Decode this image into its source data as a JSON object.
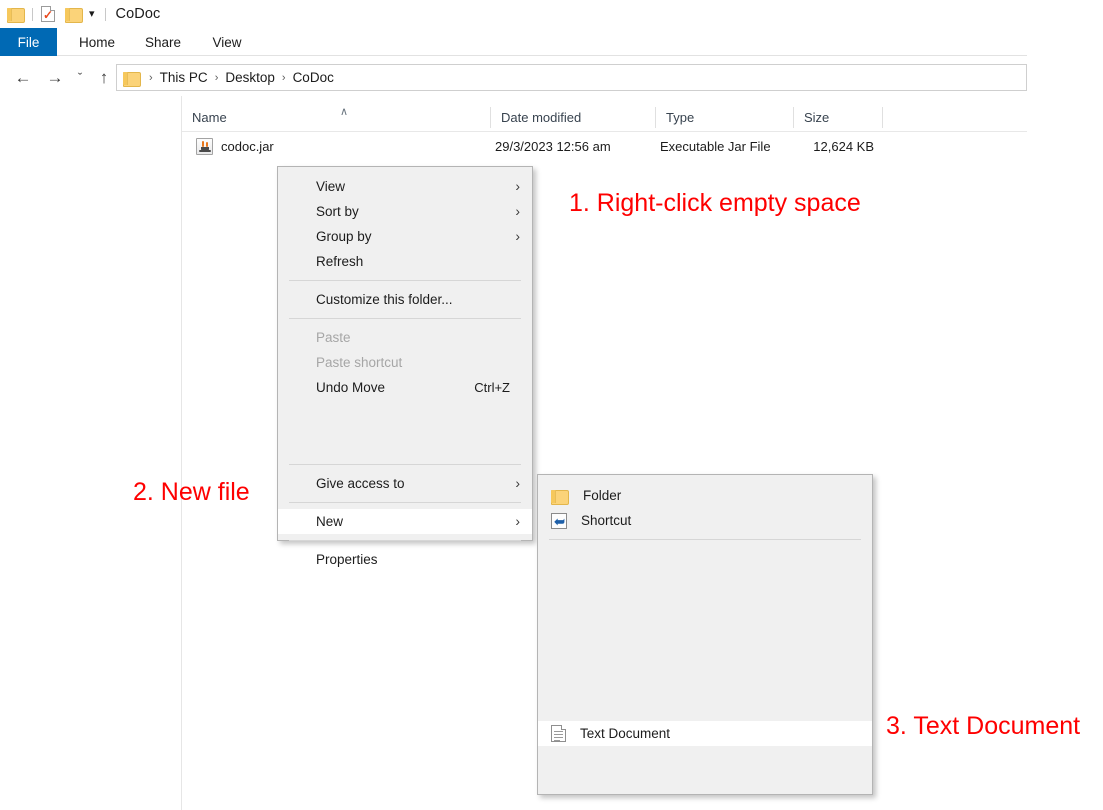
{
  "window": {
    "title": "CoDoc",
    "quick_access": [
      {
        "name": "folder-icon",
        "label": ""
      },
      {
        "name": "properties-icon",
        "label": ""
      },
      {
        "name": "new-folder-icon",
        "label": ""
      },
      {
        "name": "customize-quick-access-caret",
        "label": ""
      }
    ]
  },
  "ribbon": {
    "tabs": [
      {
        "label": "File",
        "active": true
      },
      {
        "label": "Home",
        "active": false
      },
      {
        "label": "Share",
        "active": false
      },
      {
        "label": "View",
        "active": false
      }
    ]
  },
  "address_bar": {
    "back": "←",
    "forward": "→",
    "recent": "ˇ",
    "up": "↑",
    "breadcrumbs": [
      "This PC",
      "Desktop",
      "CoDoc"
    ],
    "separator": "›"
  },
  "file_list": {
    "columns": [
      {
        "label": "Name",
        "sorted": "asc",
        "sort_glyph": "∧"
      },
      {
        "label": "Date modified",
        "sorted": "",
        "sort_glyph": ""
      },
      {
        "label": "Type",
        "sorted": "",
        "sort_glyph": ""
      },
      {
        "label": "Size",
        "sorted": "",
        "sort_glyph": ""
      }
    ],
    "rows": [
      {
        "icon": "java-jar-icon",
        "name": "codoc.jar",
        "date_modified": "29/3/2023 12:56 am",
        "type": "Executable Jar File",
        "size": "12,624 KB"
      }
    ]
  },
  "context_menu": {
    "items": [
      {
        "label": "View",
        "submenu": true,
        "disabled": false,
        "highlighted": false,
        "accel": ""
      },
      {
        "label": "Sort by",
        "submenu": true,
        "disabled": false,
        "highlighted": false,
        "accel": ""
      },
      {
        "label": "Group by",
        "submenu": true,
        "disabled": false,
        "highlighted": false,
        "accel": ""
      },
      {
        "label": "Refresh",
        "submenu": false,
        "disabled": false,
        "highlighted": false,
        "accel": ""
      },
      {
        "label": "Customize this folder...",
        "submenu": false,
        "disabled": false,
        "highlighted": false,
        "accel": ""
      },
      {
        "label": "Paste",
        "submenu": false,
        "disabled": true,
        "highlighted": false,
        "accel": ""
      },
      {
        "label": "Paste shortcut",
        "submenu": false,
        "disabled": true,
        "highlighted": false,
        "accel": ""
      },
      {
        "label": "Undo Move",
        "submenu": false,
        "disabled": false,
        "highlighted": false,
        "accel": "Ctrl+Z"
      },
      {
        "label": "Give access to",
        "submenu": true,
        "disabled": false,
        "highlighted": false,
        "accel": ""
      },
      {
        "label": "New",
        "submenu": true,
        "disabled": false,
        "highlighted": true,
        "accel": ""
      },
      {
        "label": "Properties",
        "submenu": false,
        "disabled": false,
        "highlighted": false,
        "accel": ""
      }
    ],
    "submenu_arrow": "›"
  },
  "new_submenu": {
    "items": [
      {
        "label": "Folder",
        "icon": "folder-icon",
        "highlighted": false
      },
      {
        "label": "Shortcut",
        "icon": "shortcut-icon",
        "highlighted": false
      },
      {
        "label": "Text Document",
        "icon": "text-document-icon",
        "highlighted": true
      }
    ]
  },
  "annotations": [
    {
      "text": "1. Right-click empty space",
      "color": "#fe0000"
    },
    {
      "text": "2. New file",
      "color": "#fe0000"
    },
    {
      "text": "3. Text Document",
      "color": "#fe0000"
    }
  ],
  "colors": {
    "file_tab_blue": "#0069b4",
    "annotation_red": "#fe0000",
    "menu_background": "#f0f0f0",
    "folder_yellow": "#fbd379"
  }
}
